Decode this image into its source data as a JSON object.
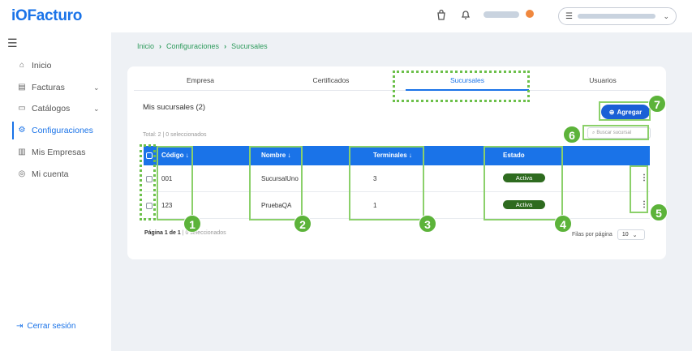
{
  "app": {
    "logo_io": "iO",
    "logo_text": "Facturo"
  },
  "header": {
    "company_menu_icon": "hamburger-icon",
    "icons": [
      "shopping-bag-icon",
      "bell-icon",
      "chevron-down-icon"
    ]
  },
  "sidebar": {
    "items": [
      {
        "label": "Inicio",
        "icon": "home-icon"
      },
      {
        "label": "Facturas",
        "icon": "invoice-icon",
        "has_chevron": true
      },
      {
        "label": "Catálogos",
        "icon": "folder-icon",
        "has_chevron": true
      },
      {
        "label": "Configuraciones",
        "icon": "gear-icon",
        "active": true
      },
      {
        "label": "Mis Empresas",
        "icon": "building-icon"
      },
      {
        "label": "Mi cuenta",
        "icon": "user-circle-icon"
      }
    ],
    "logout_label": "Cerrar sesión"
  },
  "breadcrumb": {
    "items": [
      "Inicio",
      "Configuraciones",
      "Sucursales"
    ]
  },
  "tabs": {
    "items": [
      "Empresa",
      "Certificados",
      "Sucursales",
      "Usuarios"
    ],
    "active": "Sucursales"
  },
  "section": {
    "title": "Mis sucursales (2)",
    "add_label": "Agregar",
    "total_text": "Total: 2 | 0 seleccionados",
    "search_placeholder": "Buscar sucursal"
  },
  "table": {
    "columns": [
      "Código",
      "Nombre",
      "Terminales",
      "Estado"
    ],
    "rows": [
      {
        "codigo": "001",
        "nombre": "SucursalUno",
        "terminales": "3",
        "estado": "Activa"
      },
      {
        "codigo": "123",
        "nombre": "PruebaQA",
        "terminales": "1",
        "estado": "Activa"
      }
    ]
  },
  "pagination": {
    "page_label": "Página 1 de 1",
    "selected_text": "| 0 seleccionados",
    "rows_label": "Filas por página",
    "rows_value": "10"
  },
  "annotations": [
    "1",
    "2",
    "3",
    "4",
    "5",
    "6",
    "7"
  ],
  "colors": {
    "primary": "#1a73e8",
    "accent_green": "#5cb33a",
    "badge_green": "#2e6b1f",
    "add_button": "#1a5fd6"
  }
}
